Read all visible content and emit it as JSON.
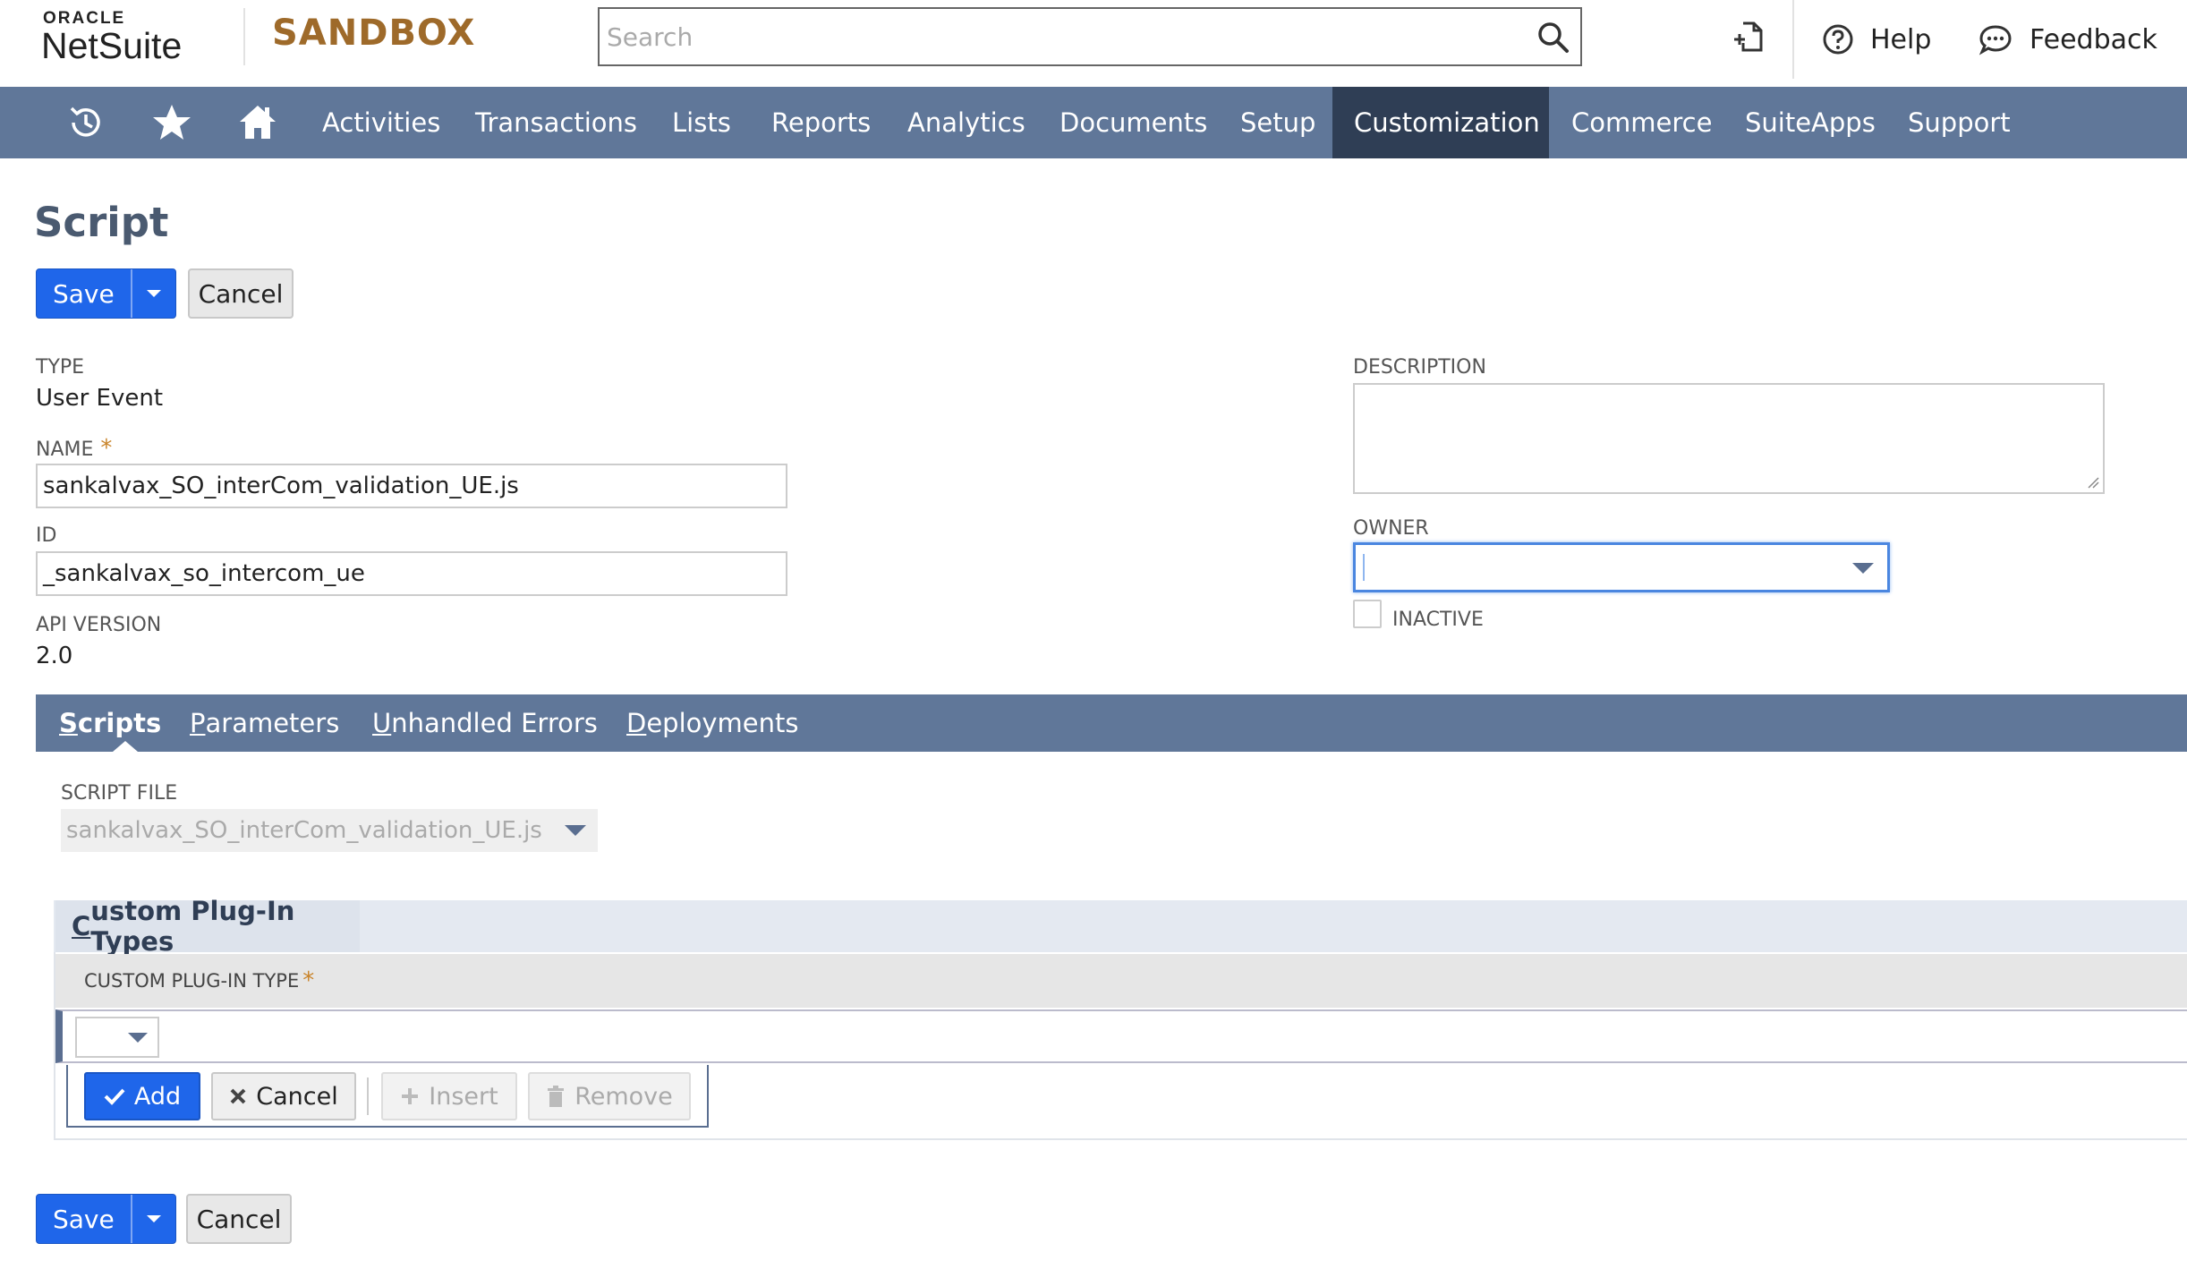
{
  "header": {
    "brand_top": "ORACLE",
    "brand_main": "NetSuite",
    "environment": "SANDBOX",
    "search_placeholder": "Search",
    "help_label": "Help",
    "feedback_label": "Feedback"
  },
  "nav": {
    "items": [
      "Activities",
      "Transactions",
      "Lists",
      "Reports",
      "Analytics",
      "Documents",
      "Setup",
      "Customization",
      "Commerce",
      "SuiteApps",
      "Support"
    ],
    "active": "Customization"
  },
  "page": {
    "title": "Script",
    "save_label": "Save",
    "cancel_label": "Cancel"
  },
  "form": {
    "type_label": "TYPE",
    "type_value": "User Event",
    "name_label": "NAME",
    "name_value": "sankalvax_SO_interCom_validation_UE.js",
    "id_label": "ID",
    "id_value": "_sankalvax_so_intercom_ue",
    "api_label": "API VERSION",
    "api_value": "2.0",
    "description_label": "DESCRIPTION",
    "owner_label": "OWNER",
    "inactive_label": "INACTIVE",
    "required_mark": "*"
  },
  "subtabs": {
    "scripts": {
      "first": "S",
      "rest": "cripts"
    },
    "parameters": {
      "first": "P",
      "rest": "arameters"
    },
    "unhandled": {
      "first": "U",
      "rest": "nhandled Errors"
    },
    "deployments": {
      "first": "D",
      "rest": "eployments"
    }
  },
  "scripts_tab": {
    "script_file_label": "SCRIPT FILE",
    "script_file_value": "sankalvax_SO_interCom_validation_UE.js"
  },
  "custom_plugins": {
    "tab_first": "C",
    "tab_rest": "ustom Plug-In Types",
    "column_label": "CUSTOM PLUG-IN TYPE",
    "add_label": "Add",
    "cancel_label": "Cancel",
    "insert_label": "Insert",
    "remove_label": "Remove"
  },
  "colors": {
    "nav_bg": "#607799",
    "nav_active": "#2f3e55",
    "primary": "#1f66ea",
    "sandbox": "#9e6a2a"
  }
}
